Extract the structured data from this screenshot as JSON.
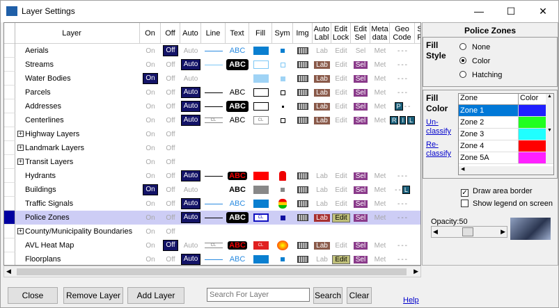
{
  "window": {
    "title": "Layer Settings",
    "icon_label": "THINK GIS",
    "min": "—",
    "max": "☐",
    "close": "✕"
  },
  "columns": [
    "Layer",
    "On",
    "Off",
    "Auto",
    "Line",
    "Text",
    "Fill",
    "Sym",
    "Img",
    "Auto Labl",
    "Edit Lock",
    "Edit Sel",
    "Meta data",
    "Geo Code",
    "S P"
  ],
  "rows": [
    {
      "name": "Aerials",
      "on": "On",
      "off": "Off",
      "auto": "Auto",
      "on_active": false,
      "off_active": true,
      "auto_active": false,
      "line": "blue",
      "text": "ABC",
      "text_style": "blue",
      "fill": "#0a7fd0",
      "fill_style": "solid",
      "sym": "blue-sq",
      "lab": "Lab",
      "lab_active": false,
      "edit": "Edit",
      "edit_active": false,
      "sel": "Sel",
      "sel_active": false,
      "met": "Met",
      "geo": "- - -"
    },
    {
      "name": "Streams",
      "on": "On",
      "off": "Off",
      "auto": "Auto",
      "on_active": false,
      "off_active": false,
      "auto_active": true,
      "line": "lightblue",
      "text": "ABC",
      "text_style": "box",
      "fill": "#ffffff",
      "fill_style": "outline-blue",
      "sym": "outline-blue",
      "lab": "Lab",
      "lab_active": true,
      "edit": "Edit",
      "edit_active": false,
      "sel": "Sel",
      "sel_active": true,
      "met": "Met",
      "geo": "- - -"
    },
    {
      "name": "Water Bodies",
      "on": "On",
      "off": "Off",
      "auto": "Auto",
      "on_active": true,
      "off_active": false,
      "auto_active": false,
      "line": "none",
      "text": "",
      "text_style": "none",
      "fill": "#9fd3f5",
      "fill_style": "solid",
      "sym": "lightblue-sq",
      "lab": "Lab",
      "lab_active": true,
      "edit": "Edit",
      "edit_active": false,
      "sel": "Sel",
      "sel_active": true,
      "met": "Met",
      "geo": "- - -"
    },
    {
      "name": "Parcels",
      "on": "On",
      "off": "Off",
      "auto": "Auto",
      "on_active": false,
      "off_active": false,
      "auto_active": true,
      "line": "black",
      "text": "ABC",
      "text_style": "plain",
      "fill": "#ffffff",
      "fill_style": "outline-black",
      "sym": "outline-black",
      "lab": "Lab",
      "lab_active": true,
      "edit": "Edit",
      "edit_active": false,
      "sel": "Sel",
      "sel_active": true,
      "met": "Met",
      "geo": "- - -"
    },
    {
      "name": "Addresses",
      "on": "On",
      "off": "Off",
      "auto": "Auto",
      "on_active": false,
      "off_active": false,
      "auto_active": true,
      "line": "black",
      "text": "ABC",
      "text_style": "box",
      "fill": "#ffffff",
      "fill_style": "outline-black",
      "sym": "dot",
      "lab": "Lab",
      "lab_active": true,
      "edit": "Edit",
      "edit_active": false,
      "sel": "Sel",
      "sel_active": true,
      "met": "Met",
      "geo": "P - -"
    },
    {
      "name": "Centerlines",
      "on": "On",
      "off": "Off",
      "auto": "Auto",
      "on_active": false,
      "off_active": false,
      "auto_active": true,
      "line": "CL",
      "text": "ABC",
      "text_style": "plain",
      "fill": "#ffffff",
      "fill_style": "CL",
      "sym": "outline-black",
      "lab": "Lab",
      "lab_active": true,
      "edit": "Edit",
      "edit_active": false,
      "sel": "Sel",
      "sel_active": true,
      "met": "Met",
      "geo": "R I L"
    },
    {
      "name": "Highway Layers",
      "group": true,
      "on": "On",
      "off": "Off"
    },
    {
      "name": "Landmark Layers",
      "group": true,
      "on": "On",
      "off": "Off"
    },
    {
      "name": "Transit Layers",
      "group": true,
      "on": "On",
      "off": "Off"
    },
    {
      "name": "Hydrants",
      "on": "On",
      "off": "Off",
      "auto": "Auto",
      "on_active": false,
      "off_active": false,
      "auto_active": true,
      "line": "black",
      "text": "ABC",
      "text_style": "red",
      "fill": "#ff0000",
      "fill_style": "solid",
      "sym": "hydrant",
      "lab": "Lab",
      "lab_active": false,
      "edit": "Edit",
      "edit_active": false,
      "sel": "Sel",
      "sel_active": true,
      "met": "Met",
      "geo": "- - -"
    },
    {
      "name": "Buildings",
      "on": "On",
      "off": "Off",
      "auto": "Auto",
      "on_active": true,
      "off_active": false,
      "auto_active": false,
      "line": "none",
      "text": "ABC",
      "text_style": "boldplain",
      "fill": "#888888",
      "fill_style": "solid",
      "sym": "grey-sq",
      "lab": "Lab",
      "lab_active": false,
      "edit": "Edit",
      "edit_active": false,
      "sel": "Sel",
      "sel_active": true,
      "met": "Met",
      "geo": "- - L"
    },
    {
      "name": "Traffic Signals",
      "on": "On",
      "off": "Off",
      "auto": "Auto",
      "on_active": false,
      "off_active": false,
      "auto_active": true,
      "line": "blue",
      "text": "ABC",
      "text_style": "blue",
      "fill": "#0a7fd0",
      "fill_style": "solid",
      "sym": "signal",
      "lab": "Lab",
      "lab_active": false,
      "edit": "Edit",
      "edit_active": false,
      "sel": "Sel",
      "sel_active": true,
      "met": "Met",
      "geo": "- - -"
    },
    {
      "name": "Police Zones",
      "selected": true,
      "on": "On",
      "off": "Off",
      "auto": "Auto",
      "on_active": false,
      "off_active": false,
      "auto_active": true,
      "line": "black",
      "text": "ABC",
      "text_style": "box",
      "fill": "#ffffff",
      "fill_style": "CL-blue",
      "sym": "navy-sq",
      "lab": "Lab",
      "lab_active": true,
      "lab_hi": true,
      "edit": "Edit",
      "edit_active": true,
      "sel": "Sel",
      "sel_active": true,
      "met": "Met",
      "geo": "- - -"
    },
    {
      "name": "County/Municipality Boundaries",
      "group": true,
      "on": "On",
      "off": "Off"
    },
    {
      "name": "AVL Heat Map",
      "on": "On",
      "off": "Off",
      "auto": "Auto",
      "on_active": false,
      "off_active": true,
      "auto_active": false,
      "line": "CL",
      "text": "ABC",
      "text_style": "red",
      "fill": "#e02020",
      "fill_style": "CL-red",
      "sym": "heat",
      "lab": "Lab",
      "lab_active": true,
      "edit": "Edit",
      "edit_active": false,
      "sel": "Sel",
      "sel_active": true,
      "met": "Met",
      "geo": "- - -"
    },
    {
      "name": "Floorplans",
      "on": "On",
      "off": "Off",
      "auto": "Auto",
      "on_active": false,
      "off_active": false,
      "auto_active": true,
      "line": "blue",
      "text": "ABC",
      "text_style": "blue",
      "fill": "#0a7fd0",
      "fill_style": "solid",
      "sym": "blue-sq",
      "lab": "Lab",
      "lab_active": false,
      "edit": "Edit",
      "edit_active": true,
      "sel": "Sel",
      "sel_active": true,
      "met": "Met",
      "geo": "- - -"
    }
  ],
  "panel": {
    "title": "Police Zones",
    "fill_style_label": "Fill Style",
    "fill_options": [
      "None",
      "Color",
      "Hatching"
    ],
    "fill_selected": "Color",
    "fill_color_label": "Fill Color",
    "unclassify": "Un-classify",
    "reclassify": "Re-classify",
    "zone_table_headers": [
      "Zone",
      "Color"
    ],
    "zones": [
      {
        "name": "Zone 1",
        "color": "#2020ff",
        "selected": true
      },
      {
        "name": "Zone 2",
        "color": "#20ff20"
      },
      {
        "name": "Zone 3",
        "color": "#20ffff"
      },
      {
        "name": "Zone 4",
        "color": "#ff0000"
      },
      {
        "name": "Zone 5A",
        "color": "#ff20ff"
      }
    ],
    "draw_border_label": "Draw area border",
    "draw_border_checked": true,
    "legend_label": "Show legend on screen",
    "legend_checked": false,
    "opacity_label": "Opacity:50",
    "opacity_value": 0.5
  },
  "footer": {
    "close": "Close",
    "remove": "Remove Layer",
    "add": "Add Layer",
    "search_placeholder": "Search For Layer",
    "search": "Search",
    "clear": "Clear",
    "help": "Help"
  }
}
